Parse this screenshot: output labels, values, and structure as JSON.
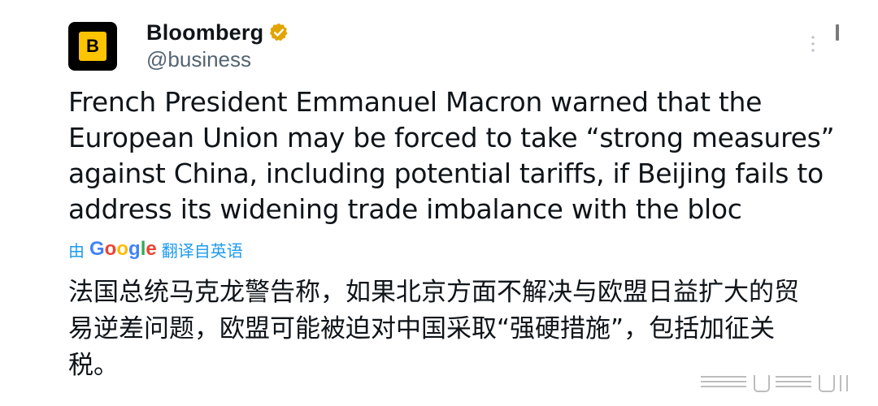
{
  "account": {
    "display_name": "Bloomberg",
    "handle": "@business",
    "avatar_letter": "B",
    "verified": true,
    "verified_color": "#e2a400"
  },
  "tweet": {
    "text": "French President Emmanuel Macron warned that the European Union may be forced to take “strong measures” against China, including potential tariffs, if Beijing fails to address its widening trade imbalance with the bloc"
  },
  "translation": {
    "prefix": "由",
    "provider": "Google",
    "suffix": "翻译自英语",
    "text": "法国总统马克龙警告称，如果北京方面不解决与欧盟日益扩大的贸易逆差问题，欧盟可能被迫对中国采取“强硬措施”，包括加征关税。"
  },
  "colors": {
    "link": "#1d9bf0",
    "avatar_bg": "#000000",
    "avatar_mark": "#ffc400",
    "handle": "#536471"
  },
  "icons": {
    "verified": "verified-badge-icon",
    "more": "more-options-icon",
    "watermark": "watermark-icon"
  }
}
